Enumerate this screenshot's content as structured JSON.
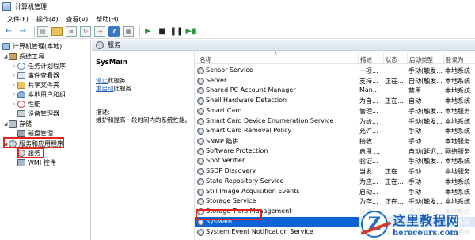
{
  "window": {
    "title": "计算机管理"
  },
  "menu": [
    "文件(F)",
    "操作(A)",
    "查看(V)",
    "帮助(H)"
  ],
  "tree": {
    "root": "计算机管理(本地)",
    "system_tools": "系统工具",
    "task_scheduler": "任务计划程序",
    "event_viewer": "事件查看器",
    "shared_folders": "共享文件夹",
    "local_users": "本地用户和组",
    "performance": "性能",
    "device_manager": "设备管理器",
    "storage": "存储",
    "disk_management": "磁盘管理",
    "services_apps": "服务和应用程序",
    "services": "服务",
    "wmi": "WMI 控件"
  },
  "pane": {
    "header": "服务",
    "selected_title": "SysMain",
    "stop_link": "停止",
    "stop_rest": "此服务",
    "restart_link": "重启动",
    "restart_rest": "此服务",
    "desc_label": "描述:",
    "desc_text": "维护和提高一段时间内的系统性能。"
  },
  "list": {
    "columns": {
      "name": "名称",
      "desc": "描述",
      "status": "状态",
      "startup": "启动类型",
      "logon": "登录为"
    },
    "rows": [
      {
        "name": "Sensor Service",
        "desc": "一项...",
        "status": "",
        "startup": "手动(触发...",
        "logon": "本地系统"
      },
      {
        "name": "Server",
        "desc": "支持...",
        "status": "正在...",
        "startup": "自动(触发...",
        "logon": "本地系统"
      },
      {
        "name": "Shared PC Account Manager",
        "desc": "Man...",
        "status": "",
        "startup": "禁用",
        "logon": "本地系统"
      },
      {
        "name": "Shell Hardware Detection",
        "desc": "为自...",
        "status": "正在...",
        "startup": "自动",
        "logon": "本地系统"
      },
      {
        "name": "Smart Card",
        "desc": "管理...",
        "status": "",
        "startup": "手动(触发...",
        "logon": "本地服务"
      },
      {
        "name": "Smart Card Device Enumeration Service",
        "desc": "为给...",
        "status": "",
        "startup": "手动(触发...",
        "logon": "本地系统"
      },
      {
        "name": "Smart Card Removal Policy",
        "desc": "允许...",
        "status": "",
        "startup": "手动",
        "logon": "本地系统"
      },
      {
        "name": "SNMP 陷阱",
        "desc": "接收...",
        "status": "",
        "startup": "手动",
        "logon": "本地服务"
      },
      {
        "name": "Software Protection",
        "desc": "启用 ...",
        "status": "",
        "startup": "自动(延迟...",
        "logon": "网络服务"
      },
      {
        "name": "Spot Verifier",
        "desc": "验证...",
        "status": "",
        "startup": "手动(触发...",
        "logon": "本地系统"
      },
      {
        "name": "SSDP Discovery",
        "desc": "当发...",
        "status": "正在...",
        "startup": "手动",
        "logon": "本地服务"
      },
      {
        "name": "State Repository Service",
        "desc": "为应...",
        "status": "正在...",
        "startup": "手动",
        "logon": "本地系统"
      },
      {
        "name": "Still Image Acquisition Events",
        "desc": "启动...",
        "status": "",
        "startup": "手动",
        "logon": "本地系统"
      },
      {
        "name": "Storage Service",
        "desc": "为存...",
        "status": "正在...",
        "startup": "手动(触发...",
        "logon": "本地系统"
      },
      {
        "name": "Storage Tiers Management",
        "desc": "优化...",
        "status": "",
        "startup": "手动",
        "logon": "本地系统"
      },
      {
        "name": "SysMain",
        "desc": "维护...",
        "status": "正在...",
        "startup": "自动",
        "logon": "本地系统",
        "selected": true
      },
      {
        "name": "System Event Notification Service",
        "desc": "监视...",
        "status": "正在...",
        "startup": "自动",
        "logon": "本地系统"
      }
    ]
  },
  "watermark": {
    "cn": "这里教程网",
    "en": "herecours.com",
    "logo": "Z"
  }
}
